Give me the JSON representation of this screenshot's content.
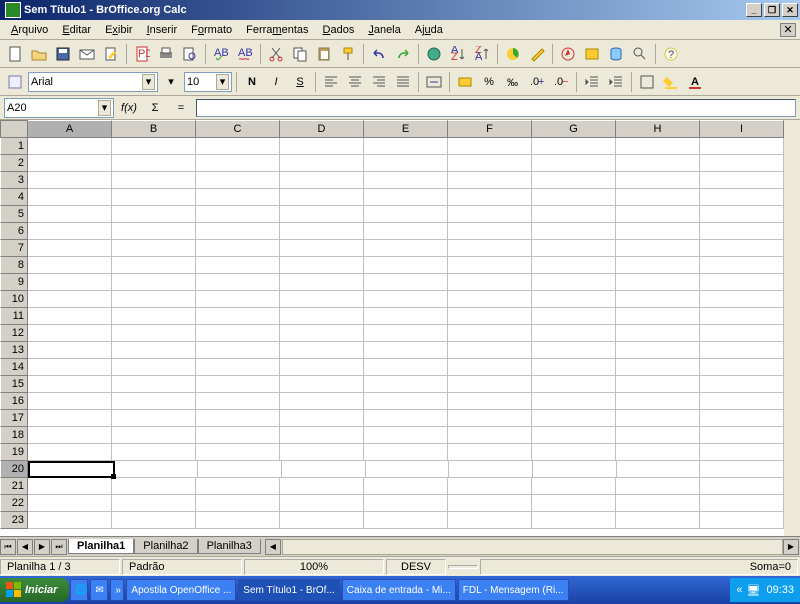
{
  "window": {
    "title": "Sem Título1 - BrOffice.org Calc"
  },
  "menu": [
    "Arquivo",
    "Editar",
    "Exibir",
    "Inserir",
    "Formato",
    "Ferramentas",
    "Dados",
    "Janela",
    "Ajuda"
  ],
  "format": {
    "font": "Arial",
    "size": "10"
  },
  "formula": {
    "cellref": "A20",
    "fx": "f(x)",
    "sigma": "Σ",
    "eq": "="
  },
  "columns": [
    "A",
    "B",
    "C",
    "D",
    "E",
    "F",
    "G",
    "H",
    "I"
  ],
  "rows": 23,
  "activeRow": 20,
  "activeCol": "A",
  "sheets": {
    "active": "Planilha1",
    "others": [
      "Planilha2",
      "Planilha3"
    ]
  },
  "status": {
    "sheet": "Planilha 1 / 3",
    "style": "Padrão",
    "zoom": "100%",
    "mode": "DESV",
    "sum": "Soma=0"
  },
  "taskbar": {
    "start": "Iniciar",
    "items": [
      "Apostila OpenOffice ...",
      "Sem Título1 - BrOf...",
      "Caixa de entrada - Mi...",
      "FDL - Mensagem (Ri..."
    ],
    "activeIndex": 1,
    "time": "09:33"
  }
}
